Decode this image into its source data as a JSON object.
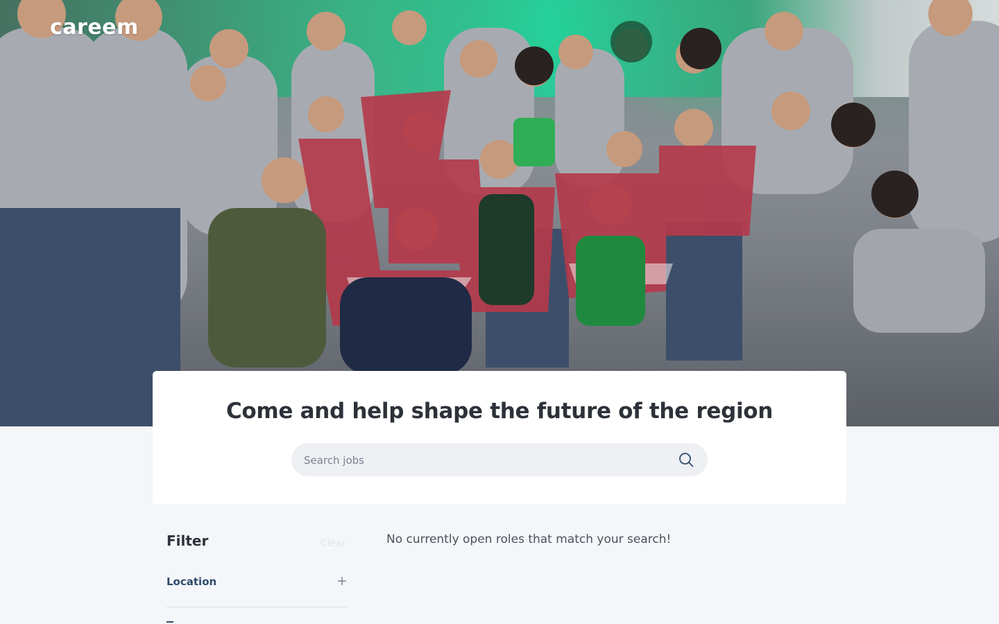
{
  "brand": {
    "logo_text": "careem"
  },
  "hero": {
    "headline": "Come and help shape the future of the region"
  },
  "search": {
    "placeholder": "Search jobs",
    "icon": "search-icon"
  },
  "filter": {
    "title": "Filter",
    "clear_label": "Clear",
    "sections": [
      {
        "label": "Location",
        "icon": "plus-icon"
      }
    ]
  },
  "results": {
    "empty_message": "No currently open roles that match your search!"
  },
  "colors": {
    "accent_green": "#1fd29a",
    "filter_label": "#2f4a6b",
    "search_bg": "#eef0f3",
    "page_bg": "#f4f6f9"
  }
}
